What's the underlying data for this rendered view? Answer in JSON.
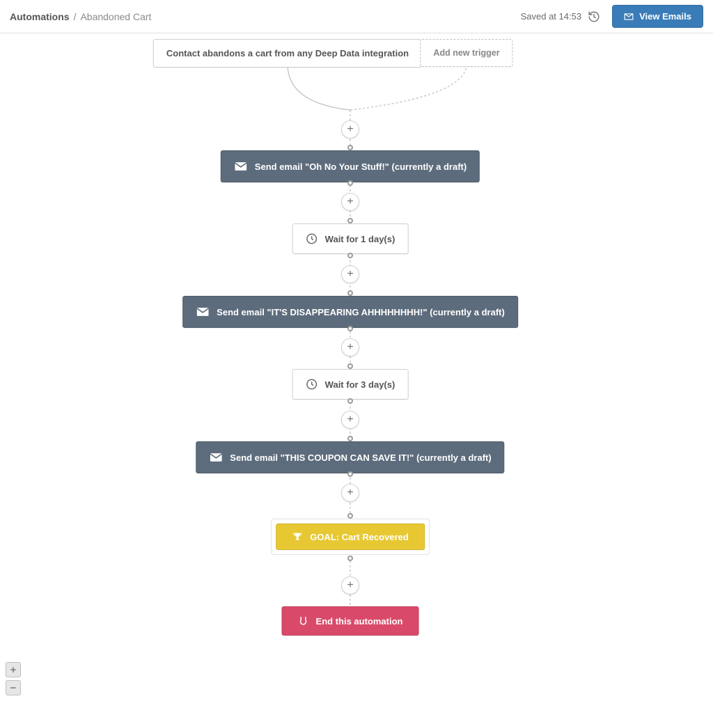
{
  "header": {
    "breadcrumb_root": "Automations",
    "breadcrumb_sep": "/",
    "breadcrumb_current": "Abandoned Cart",
    "saved_text": "Saved at 14:53",
    "view_emails_label": "View Emails"
  },
  "triggers": {
    "trigger_label": "Contact abandons a cart from any Deep Data integration",
    "add_trigger_label": "Add new trigger"
  },
  "steps": {
    "email1": "Send email \"Oh No Your Stuff!\" (currently a draft)",
    "wait1": "Wait for 1 day(s)",
    "email2": "Send email \"IT'S DISAPPEARING AHHHHHHHH!\" (currently a draft)",
    "wait2": "Wait for 3 day(s)",
    "email3": "Send email \"THIS COUPON CAN SAVE IT!\" (currently a draft)",
    "goal": "GOAL: Cart Recovered",
    "end": "End this automation"
  },
  "zoom": {
    "in": "+",
    "out": "−"
  }
}
